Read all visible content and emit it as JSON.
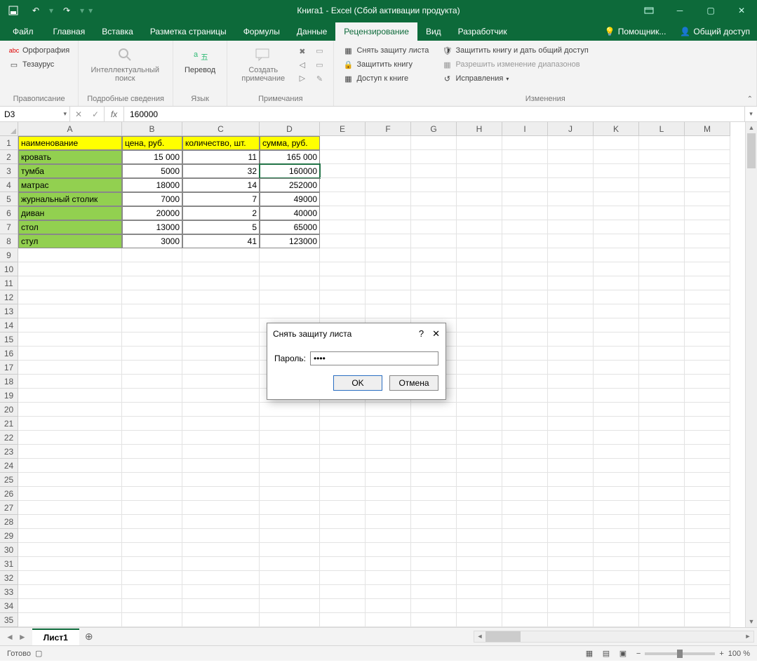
{
  "titlebar": {
    "title": "Книга1 - Excel (Сбой активации продукта)"
  },
  "tabs": {
    "file": "Файл",
    "items": [
      "Главная",
      "Вставка",
      "Разметка страницы",
      "Формулы",
      "Данные",
      "Рецензирование",
      "Вид",
      "Разработчик"
    ],
    "active": "Рецензирование",
    "helper": "Помощник...",
    "share": "Общий доступ"
  },
  "ribbon": {
    "groups": [
      {
        "label": "Правописание",
        "items": [
          {
            "text": "Орфография"
          },
          {
            "text": "Тезаурус"
          }
        ]
      },
      {
        "label": "Подробные сведения",
        "items": [
          {
            "text": "Интеллектуальный поиск"
          }
        ]
      },
      {
        "label": "Язык",
        "items": [
          {
            "text": "Перевод"
          }
        ]
      },
      {
        "label": "Примечания",
        "items": [
          {
            "text": "Создать примечание"
          }
        ]
      },
      {
        "label": "Изменения",
        "items": [
          {
            "text": "Снять защиту листа"
          },
          {
            "text": "Защитить книгу"
          },
          {
            "text": "Доступ к книге"
          },
          {
            "text": "Защитить книгу и дать общий доступ"
          },
          {
            "text": "Разрешить изменение диапазонов"
          },
          {
            "text": "Исправления"
          }
        ]
      }
    ]
  },
  "namebar": {
    "ref": "D3",
    "formula": "160000"
  },
  "grid": {
    "cols": [
      "A",
      "B",
      "C",
      "D",
      "E",
      "F",
      "G",
      "H",
      "I",
      "J",
      "K",
      "L",
      "M"
    ],
    "header": [
      "наименование",
      "цена, руб.",
      "количество, шт.",
      "сумма, руб."
    ],
    "rows": [
      [
        "кровать",
        "15 000",
        "11",
        "165 000"
      ],
      [
        "тумба",
        "5000",
        "32",
        "160000"
      ],
      [
        "матрас",
        "18000",
        "14",
        "252000"
      ],
      [
        "журнальный столик",
        "7000",
        "7",
        "49000"
      ],
      [
        "диван",
        "20000",
        "2",
        "40000"
      ],
      [
        "стол",
        "13000",
        "5",
        "65000"
      ],
      [
        "стул",
        "3000",
        "41",
        "123000"
      ]
    ],
    "selectedCell": "D3",
    "totalRows": 35
  },
  "sheets": {
    "active": "Лист1"
  },
  "dialog": {
    "title": "Снять защиту листа",
    "passLabel": "Пароль:",
    "passValue": "••••",
    "ok": "OK",
    "cancel": "Отмена"
  },
  "status": {
    "ready": "Готово",
    "zoom": "100 %"
  }
}
